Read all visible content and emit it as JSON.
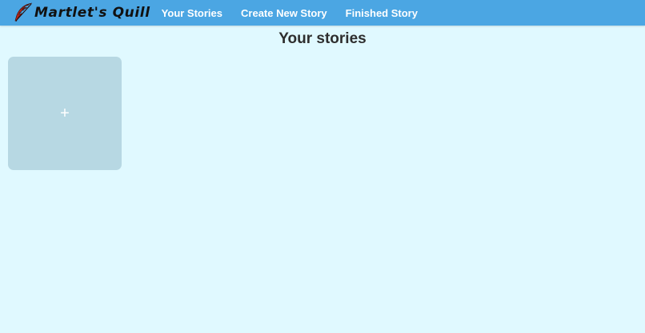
{
  "navbar": {
    "brand": "Martlet's Quill",
    "brand_icon": "quill-feather-icon",
    "links": [
      {
        "label": "Your Stories"
      },
      {
        "label": "Create New Story"
      },
      {
        "label": "Finished Story"
      }
    ]
  },
  "main": {
    "title": "Your stories",
    "add_card": {
      "symbol": "+",
      "icon": "plus-icon"
    }
  },
  "colors": {
    "navbar_bg": "#4ba6e3",
    "page_bg": "#e0f9ff",
    "card_bg": "#b7d8e3",
    "quill": "#b5281c"
  }
}
